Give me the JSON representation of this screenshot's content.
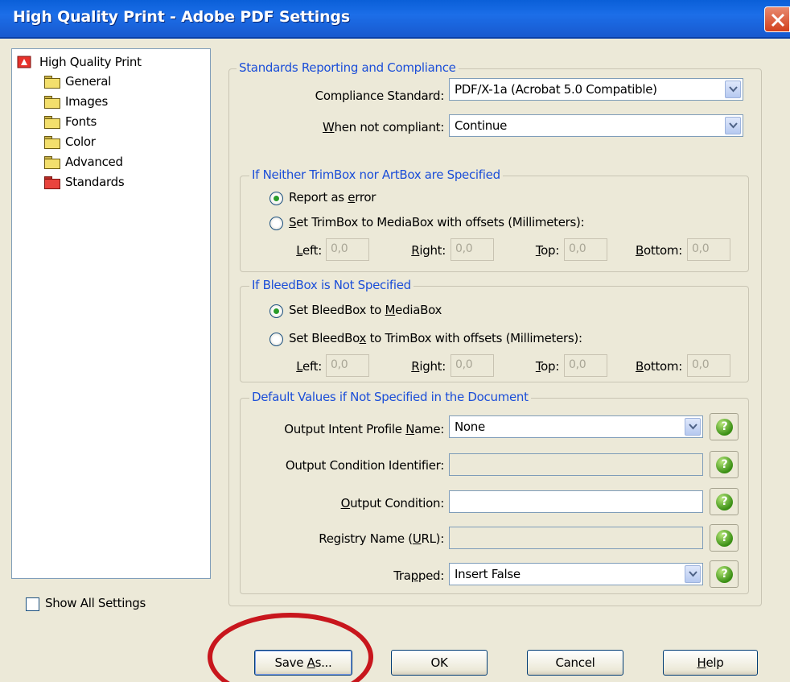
{
  "window": {
    "title": "High Quality Print - Adobe PDF Settings"
  },
  "tree": {
    "root": "High Quality Print",
    "items": [
      "General",
      "Images",
      "Fonts",
      "Color",
      "Advanced",
      "Standards"
    ]
  },
  "show_all_settings": "Show All Settings",
  "standards_group": {
    "title": "Standards Reporting and Compliance",
    "compliance_label": "Compliance Standard:",
    "compliance_value": "PDF/X-1a (Acrobat 5.0 Compatible)",
    "when_not_compliant_label": "When not compliant:",
    "when_not_compliant_value": "Continue"
  },
  "trimbox_group": {
    "title": "If Neither TrimBox nor ArtBox are Specified",
    "option_report": "Report as error",
    "option_set": "Set TrimBox to MediaBox with offsets (Millimeters):",
    "left_label": "Left:",
    "left_value": "0,0",
    "right_label": "Right:",
    "right_value": "0,0",
    "top_label": "Top:",
    "top_value": "0,0",
    "bottom_label": "Bottom:",
    "bottom_value": "0,0"
  },
  "bleedbox_group": {
    "title": "If BleedBox is Not Specified",
    "option_media": "Set BleedBox to MediaBox",
    "option_trim": "Set BleedBox to TrimBox with offsets (Millimeters):",
    "left_label": "Left:",
    "left_value": "0,0",
    "right_label": "Right:",
    "right_value": "0,0",
    "top_label": "Top:",
    "top_value": "0,0",
    "bottom_label": "Bottom:",
    "bottom_value": "0,0"
  },
  "defaults_group": {
    "title": "Default Values if Not Specified in the Document",
    "profile_label": "Output Intent Profile Name:",
    "profile_value": "None",
    "condition_id_label": "Output Condition Identifier:",
    "condition_id_value": "",
    "condition_label": "Output Condition:",
    "condition_value": "",
    "registry_label": "Registry Name (URL):",
    "registry_value": "",
    "trapped_label": "Trapped:",
    "trapped_value": "Insert False",
    "help_glyph": "?"
  },
  "buttons": {
    "save_as": "Save As...",
    "ok": "OK",
    "cancel": "Cancel",
    "help": "Help"
  },
  "colors": {
    "title_bar": "#1c6ee8",
    "group_title": "#1b4ed8",
    "highlight": "#c8161d"
  }
}
